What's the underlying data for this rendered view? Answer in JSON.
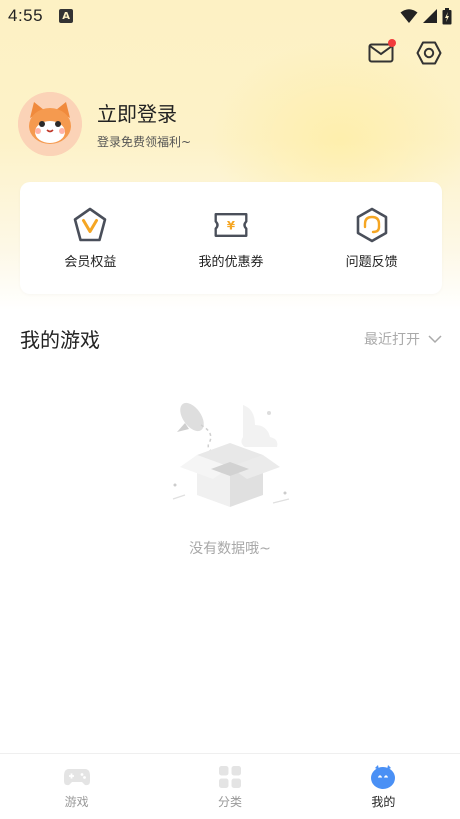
{
  "status_bar": {
    "time": "4:55",
    "indicator": "A"
  },
  "header": {
    "mail_icon": "mail-icon",
    "settings_icon": "settings-icon",
    "has_unread": true
  },
  "profile": {
    "title": "立即登录",
    "subtitle": "登录免费领福利~"
  },
  "quick_actions": [
    {
      "label": "会员权益",
      "icon": "vip-icon"
    },
    {
      "label": "我的优惠券",
      "icon": "coupon-icon"
    },
    {
      "label": "问题反馈",
      "icon": "feedback-icon"
    }
  ],
  "games": {
    "title": "我的游戏",
    "sort_label": "最近打开",
    "empty_text": "没有数据哦~"
  },
  "tabs": [
    {
      "label": "游戏",
      "icon": "gamepad-icon",
      "active": false
    },
    {
      "label": "分类",
      "icon": "grid-icon",
      "active": false
    },
    {
      "label": "我的",
      "icon": "profile-icon",
      "active": true
    }
  ],
  "colors": {
    "accent": "#f5a623",
    "icon_dark": "#4a4f5a",
    "active_blue": "#4a90f5"
  }
}
